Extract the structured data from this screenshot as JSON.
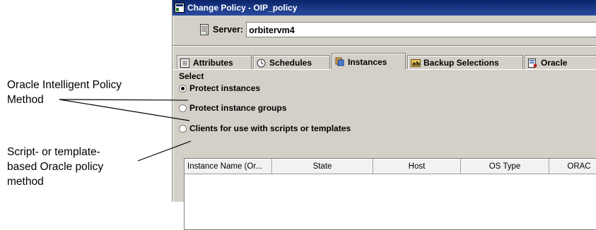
{
  "callouts": {
    "oracle_intelligent": [
      "Oracle Intelligent Policy",
      "Method"
    ],
    "script_template": [
      "Script- or template-",
      "based Oracle policy",
      "method"
    ]
  },
  "dialog": {
    "title": "Change Policy - OIP_policy",
    "server_label": "Server:",
    "server_value": "orbitervm4"
  },
  "tabs": [
    {
      "label": "Attributes",
      "icon": "attributes-icon",
      "active": false
    },
    {
      "label": "Schedules",
      "icon": "schedules-icon",
      "active": false
    },
    {
      "label": "Instances",
      "icon": "instances-icon",
      "active": true
    },
    {
      "label": "Backup Selections",
      "icon": "backup-selections-icon",
      "active": false
    },
    {
      "label": "Oracle",
      "icon": "oracle-icon",
      "active": false
    }
  ],
  "instances_panel": {
    "select_label": "Select",
    "options": [
      {
        "label": "Protect instances",
        "selected": true
      },
      {
        "label": "Protect instance groups",
        "selected": false
      },
      {
        "label": "Clients for use with scripts or templates",
        "selected": false
      }
    ],
    "table_columns": [
      "Instance Name (Or...",
      "State",
      "Host",
      "OS Type",
      "ORAC"
    ]
  },
  "colors": {
    "titlebar": "#0a246a",
    "dialog_bg": "#d4d0c8"
  }
}
